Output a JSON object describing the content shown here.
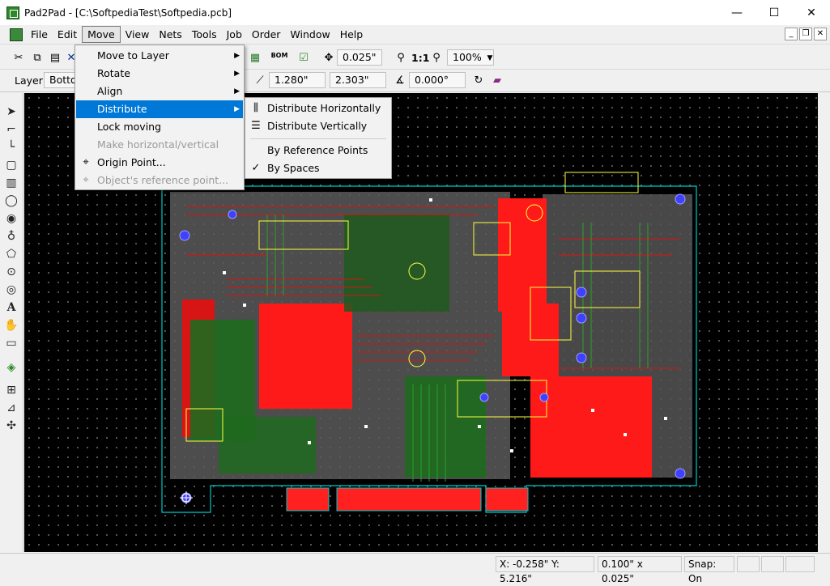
{
  "window": {
    "title": "Pad2Pad - [C:\\SoftpediaTest\\Softpedia.pcb]",
    "minimize": "—",
    "maximize": "☐",
    "close": "✕"
  },
  "menubar": {
    "items": [
      "File",
      "Edit",
      "Move",
      "View",
      "Nets",
      "Tools",
      "Job",
      "Order",
      "Window",
      "Help"
    ]
  },
  "toolbar1": {
    "grid_value": "0.025\"",
    "zoom_value": "100%",
    "zoom_one": "1:1",
    "bom_label": "BOM"
  },
  "toolbar2": {
    "layer_label": "Layer:",
    "layer_value": "Bottom",
    "x_value": "1.280\"",
    "y_value": "2.303\"",
    "angle_value": "0.000°"
  },
  "move_menu": {
    "items": [
      {
        "label": "Move to Layer",
        "submenu": true,
        "disabled": false
      },
      {
        "label": "Rotate",
        "submenu": true,
        "disabled": false
      },
      {
        "label": "Align",
        "submenu": true,
        "disabled": false
      },
      {
        "label": "Distribute",
        "submenu": true,
        "disabled": false,
        "highlight": true
      },
      {
        "label": "Lock moving",
        "submenu": false,
        "disabled": false
      },
      {
        "label": "Make horizontal/vertical",
        "submenu": false,
        "disabled": true
      },
      {
        "label": "Origin Point...",
        "submenu": false,
        "disabled": false
      },
      {
        "label": "Object's reference point...",
        "submenu": false,
        "disabled": true
      }
    ]
  },
  "distribute_menu": {
    "items": [
      {
        "label": "Distribute Horizontally"
      },
      {
        "label": "Distribute Vertically"
      },
      {
        "label": "By Reference Points",
        "checked": false
      },
      {
        "label": "By Spaces",
        "checked": true
      }
    ]
  },
  "status": {
    "coords": "X: -0.258\" Y: 5.216\"",
    "grid": "0.100\" x 0.025\"",
    "snap": "Snap: On"
  },
  "colors": {
    "board_red": "#ff1a1a",
    "trace_red": "#e01010",
    "copper_green": "#1e7a1e",
    "outline_cyan": "#00c8c8",
    "pad_blue": "#3030ff",
    "silkscreen": "#ffff40",
    "menu_highlight": "#0078d7"
  }
}
